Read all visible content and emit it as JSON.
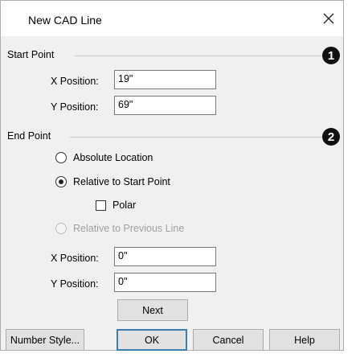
{
  "dialog": {
    "title": "New CAD Line",
    "close_icon": "close-icon"
  },
  "start_point": {
    "label": "Start Point",
    "callout": "1",
    "x_label": "X Position:",
    "x_value": "19\"",
    "y_label": "Y Position:",
    "y_value": "69\""
  },
  "end_point": {
    "label": "End Point",
    "callout": "2",
    "options": {
      "absolute": "Absolute Location",
      "relative_start": "Relative to Start Point",
      "polar": "Polar",
      "relative_previous": "Relative to Previous Line"
    },
    "selected": "relative_start",
    "polar_checked": false,
    "x_label": "X Position:",
    "x_value": "0\"",
    "y_label": "Y Position:",
    "y_value": "0\"",
    "next_label": "Next"
  },
  "footer": {
    "number_style": "Number Style...",
    "ok": "OK",
    "cancel": "Cancel",
    "help": "Help"
  }
}
